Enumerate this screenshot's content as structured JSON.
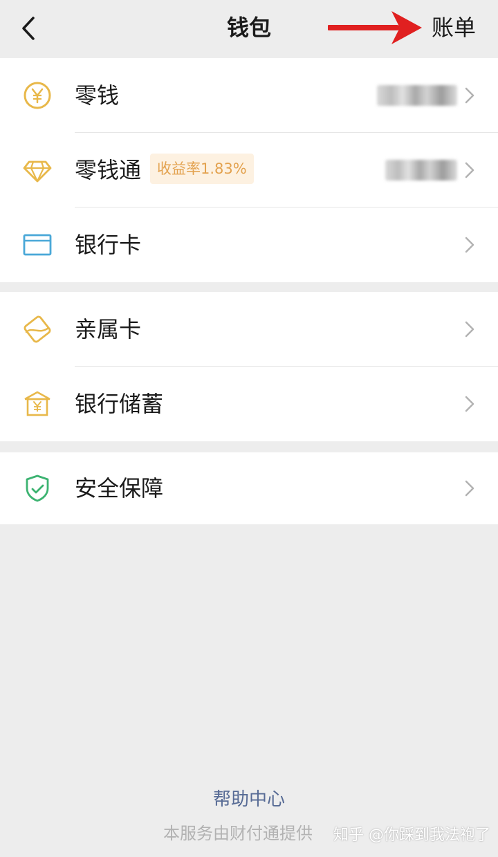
{
  "header": {
    "title": "钱包",
    "bill_label": "账单"
  },
  "groups": [
    {
      "items": [
        {
          "label": "零钱",
          "icon": "yuan-coin-icon",
          "value_hidden": true
        },
        {
          "label": "零钱通",
          "icon": "diamond-icon",
          "badge": "收益率1.83%",
          "value_hidden": true
        },
        {
          "label": "银行卡",
          "icon": "bank-card-icon"
        }
      ]
    },
    {
      "items": [
        {
          "label": "亲属卡",
          "icon": "family-card-icon"
        },
        {
          "label": "银行储蓄",
          "icon": "bank-savings-icon"
        }
      ]
    },
    {
      "items": [
        {
          "label": "安全保障",
          "icon": "shield-icon"
        }
      ]
    }
  ],
  "footer": {
    "help_label": "帮助中心",
    "service_text": "本服务由财付通提供",
    "watermark": "知乎 @你踩到我法袍了"
  },
  "colors": {
    "background": "#ededed",
    "link": "#576b95",
    "badge_text": "#e3a24f",
    "badge_bg": "#fdf1e1",
    "arrow": "#e02020",
    "icon_gold": "#e8b84a",
    "icon_blue": "#4aa8d8",
    "icon_green": "#3cb371"
  }
}
